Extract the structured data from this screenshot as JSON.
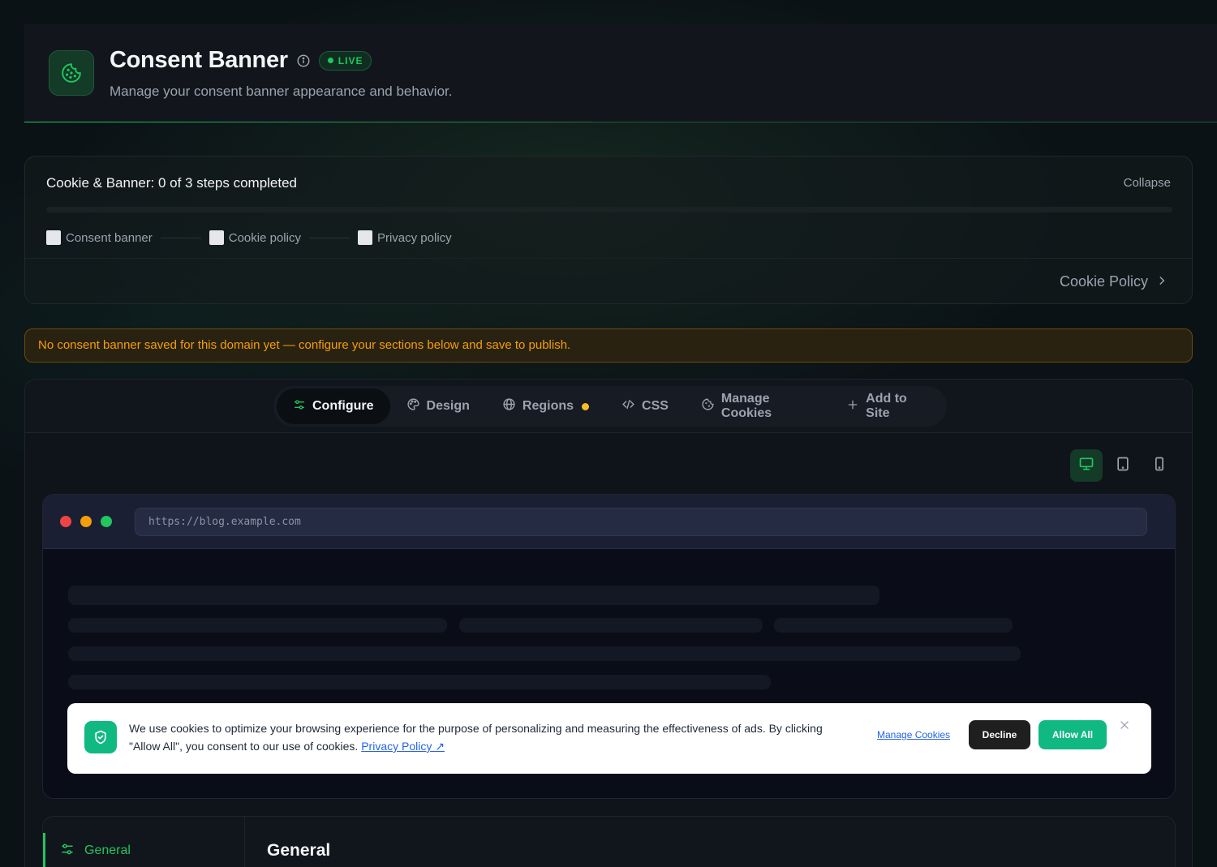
{
  "header": {
    "title": "Consent Banner",
    "badge": "LIVE",
    "subtitle": "Manage your consent banner appearance and behavior."
  },
  "steps": {
    "title": "Cookie & Banner: 0 of 3 steps completed",
    "collapse_label": "Collapse",
    "progress": 0,
    "items": [
      {
        "label": "Consent banner",
        "checked": false
      },
      {
        "label": "Cookie policy",
        "checked": false
      },
      {
        "label": "Privacy policy",
        "checked": false
      }
    ],
    "next_link": "Cookie Policy"
  },
  "warning": "No consent banner saved for this domain yet — configure your sections below and save to publish.",
  "tabs": [
    {
      "label": "Configure",
      "icon": "sliders-icon",
      "active": true
    },
    {
      "label": "Design",
      "icon": "palette-icon"
    },
    {
      "label": "Regions",
      "icon": "globe-icon",
      "indicator": true
    },
    {
      "label": "CSS",
      "icon": "code-icon"
    },
    {
      "label": "Manage Cookies",
      "icon": "cookie-icon"
    },
    {
      "label": "Add to Site",
      "icon": "plus-icon"
    }
  ],
  "device_modes": [
    "desktop-icon",
    "tablet-icon",
    "mobile-icon"
  ],
  "preview": {
    "url": "https://blog.example.com",
    "banner": {
      "text": "We use cookies to optimize your browsing experience for the purpose of personalizing and measuring the effectiveness of ads. By clicking \"Allow All\", you consent to our use of cookies.",
      "privacy_link": "Privacy Policy ↗",
      "manage_label": "Manage Cookies",
      "decline_label": "Decline",
      "allow_label": "Allow All"
    }
  },
  "settings": {
    "nav_item": "General",
    "section_title": "General"
  },
  "colors": {
    "accent": "#22c55e",
    "warning": "#f59e0b",
    "banner_primary": "#10b981"
  }
}
